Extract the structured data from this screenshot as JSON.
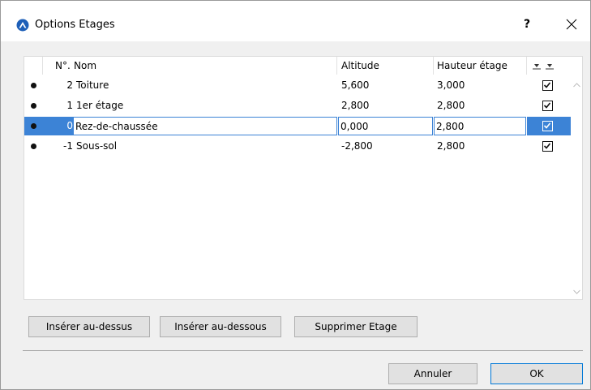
{
  "window": {
    "title": "Options Etages",
    "help_label": "?"
  },
  "table": {
    "columns": {
      "num": "N°.",
      "name": "Nom",
      "altitude": "Altitude",
      "height": "Hauteur étage"
    },
    "rows": [
      {
        "num": "2",
        "name": "Toiture",
        "altitude": "5,600",
        "height": "3,000",
        "checked": true,
        "selected": false
      },
      {
        "num": "1",
        "name": "1er étage",
        "altitude": "2,800",
        "height": "2,800",
        "checked": true,
        "selected": false
      },
      {
        "num": "0",
        "name": "Rez-de-chaussée",
        "altitude": "0,000",
        "height": "2,800",
        "checked": true,
        "selected": true
      },
      {
        "num": "-1",
        "name": "Sous-sol",
        "altitude": "-2,800",
        "height": "2,800",
        "checked": true,
        "selected": false
      }
    ]
  },
  "actions": {
    "insert_above": "Insérer au-dessus",
    "insert_below": "Insérer au-dessous",
    "delete": "Supprimer Etage"
  },
  "footer": {
    "cancel": "Annuler",
    "ok": "OK"
  },
  "colors": {
    "selection": "#3c83d6",
    "default_button_border": "#0078d7"
  }
}
